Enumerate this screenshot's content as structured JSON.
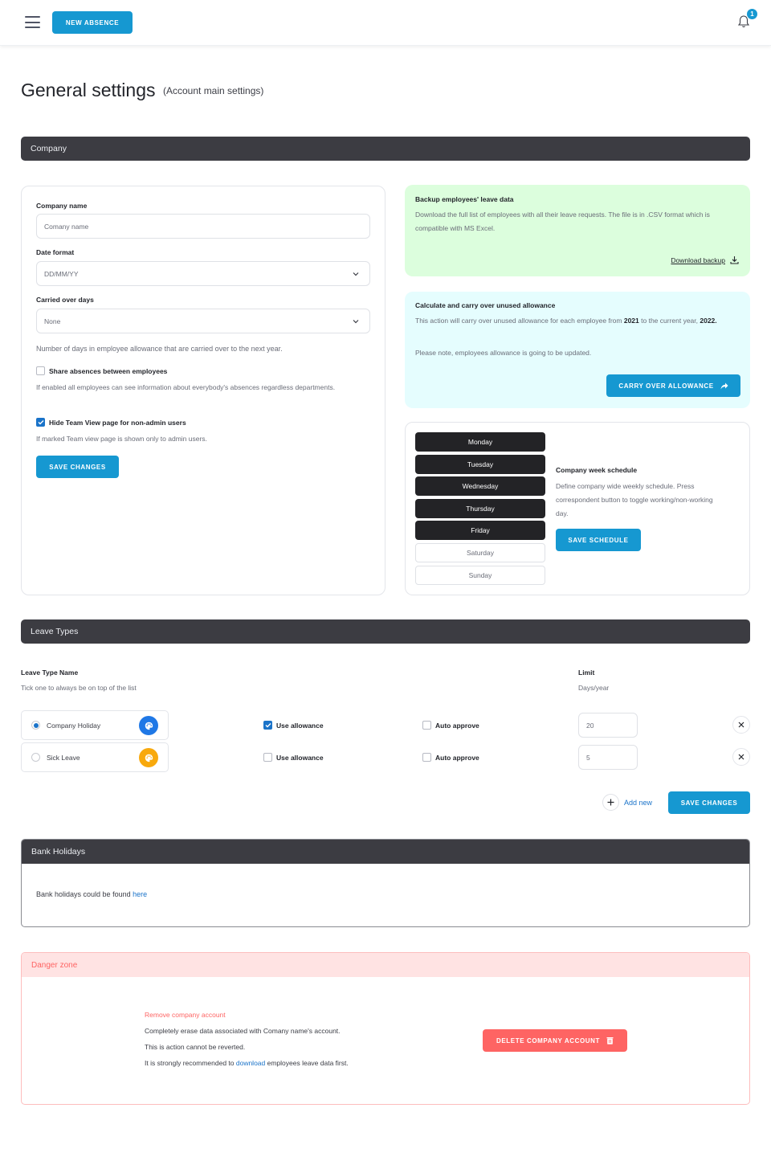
{
  "topbar": {
    "menu_icon": "hamburger-icon",
    "new_absence_label": "NEW ABSENCE",
    "notification_icon": "bell-icon",
    "notification_count": "1"
  },
  "page": {
    "title": "General settings",
    "subtitle": "(Account main settings)"
  },
  "company": {
    "section_title": "Company",
    "company_name_label": "Company name",
    "company_name_placeholder": "Comany name",
    "company_name_value": "",
    "date_format_label": "Date format",
    "date_format_value": "DD/MM/YY",
    "carried_over_label": "Carried over days",
    "carried_over_value": "None",
    "carried_over_help": "Number of days in employee allowance that are carried over to the next year.",
    "share_absences_label": "Share absences between employees",
    "share_absences_checked": false,
    "share_absences_help": "If enabled all employees can see information about everybody's absences regardless departments.",
    "hide_team_view_label": "Hide Team View page for non-admin users",
    "hide_team_view_checked": true,
    "hide_team_view_help": "If marked Team view page is shown only to admin users.",
    "save_label": "SAVE CHANGES"
  },
  "backup": {
    "title": "Backup employees' leave data",
    "description": "Download the full list of employees with all their leave requests. The file is in .CSV format which is compatible with MS Excel.",
    "link_label": "Download backup",
    "icon": "download-icon",
    "bg_color": "#dcfedd"
  },
  "carry_over": {
    "title": "Calculate and carry over unused allowance",
    "text_before": "This action will carry over unused allowance for each employee from ",
    "from_year": "2021",
    "text_middle": " to the current year, ",
    "to_year": "2022.",
    "note": "Please note, employees allowance is going to be updated.",
    "button_label": "CARRY OVER ALLOWANCE",
    "button_icon": "share-arrow-icon",
    "bg_color": "#e5fdfe"
  },
  "schedule": {
    "days": [
      {
        "label": "Monday",
        "working": true
      },
      {
        "label": "Tuesday",
        "working": true
      },
      {
        "label": "Wednesday",
        "working": true
      },
      {
        "label": "Thursday",
        "working": true
      },
      {
        "label": "Friday",
        "working": true
      },
      {
        "label": "Saturday",
        "working": false
      },
      {
        "label": "Sunday",
        "working": false
      }
    ],
    "title": "Company week schedule",
    "description": "Define company wide weekly schedule. Press correspondent button to toggle working/non-working day.",
    "save_label": "SAVE SCHEDULE"
  },
  "leave_types": {
    "section_title": "Leave Types",
    "name_header": "Leave Type Name",
    "name_help": "Tick one to always be on top of the list",
    "limit_header": "Limit",
    "limit_help": "Days/year",
    "rows": [
      {
        "name": "Company Holiday",
        "primary": true,
        "color": "#1f78e6",
        "use_allowance": true,
        "use_allowance_label": "Use allowance",
        "auto_approve": false,
        "auto_approve_label": "Auto approve",
        "limit": "20"
      },
      {
        "name": "Sick Leave",
        "primary": false,
        "color": "#f8a90d",
        "use_allowance": false,
        "use_allowance_label": "Use allowance",
        "auto_approve": false,
        "auto_approve_label": "Auto approve",
        "limit": "5"
      }
    ],
    "add_new_label": "Add new",
    "save_label": "SAVE CHANGES"
  },
  "bank_holidays": {
    "section_title": "Bank Holidays",
    "text": "Bank holidays could be found ",
    "link": "here"
  },
  "danger": {
    "section_title": "Danger zone",
    "title": "Remove company account",
    "line1": "Completely erase data associated with Comany name's account.",
    "line2": "This is action cannot be reverted.",
    "line3_before": "It is strongly recommended to ",
    "line3_link": "download",
    "line3_after": " employees leave data first.",
    "button_label": "DELETE COMPANY ACCOUNT",
    "button_icon": "trash-icon",
    "accent_color": "#fe6463"
  }
}
